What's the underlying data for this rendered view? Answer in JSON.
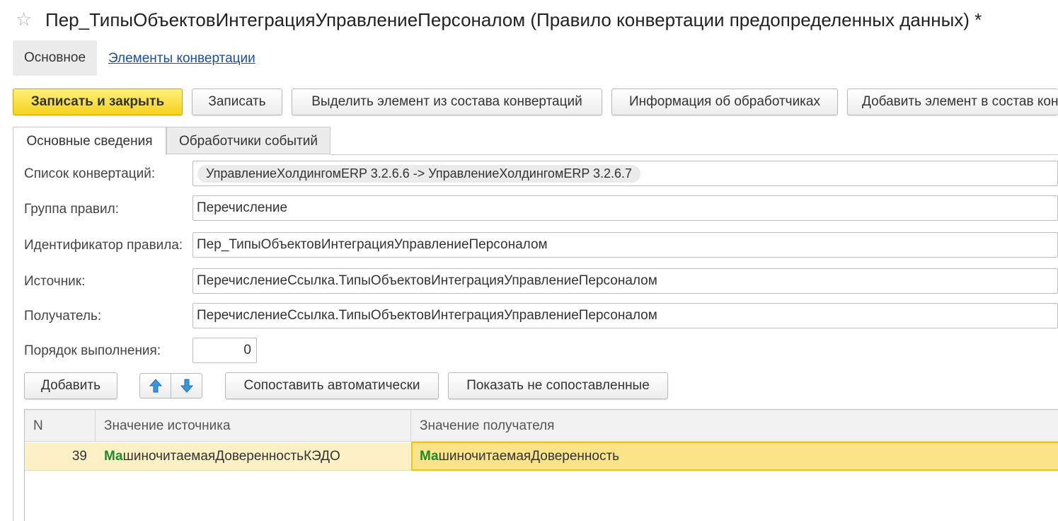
{
  "window": {
    "favorite_icon": "star-icon",
    "title": "Пер_ТипыОбъектовИнтеграцияУправлениеПерсоналом (Правило конвертации предопределенных данных) *"
  },
  "page_nav": {
    "active": "Основное",
    "link": "Элементы конвертации"
  },
  "toolbar": {
    "save_close": "Записать и закрыть",
    "save": "Записать",
    "extract_element": "Выделить элемент из состава конвертаций",
    "handlers_info": "Информация об обработчиках",
    "add_element": "Добавить элемент в состав конвертаций"
  },
  "tabs": [
    {
      "label": "Основные сведения",
      "active": true
    },
    {
      "label": "Обработчики событий",
      "active": false
    }
  ],
  "form": {
    "conversions_label": "Список конвертаций:",
    "conversions_value": "УправлениеХолдингомERP 3.2.6.6 -> УправлениеХолдингомERP 3.2.6.7",
    "group_label": "Группа правил:",
    "group_value": "Перечисление",
    "rule_id_label": "Идентификатор правила:",
    "rule_id_value": "Пер_ТипыОбъектовИнтеграцияУправлениеПерсоналом",
    "source_label": "Источник:",
    "source_value": "ПеречислениеСсылка.ТипыОбъектовИнтеграцияУправлениеПерсоналом",
    "receiver_label": "Получатель:",
    "receiver_value": "ПеречислениеСсылка.ТипыОбъектовИнтеграцияУправлениеПерсоналом",
    "order_label": "Порядок выполнения:",
    "order_value": "0"
  },
  "table_toolbar": {
    "add": "Добавить",
    "up_icon": "arrow-up-icon",
    "down_icon": "arrow-down-icon",
    "auto_match": "Сопоставить автоматически",
    "show_unmatched": "Показать не сопоставленные"
  },
  "table": {
    "columns": [
      "N",
      "Значение источника",
      "Значение получателя"
    ],
    "rows": [
      {
        "n": "39",
        "source_highlight": "Ма",
        "source_rest": "шиночитаемаяДоверенностьКЭДО",
        "target_highlight": "Ма",
        "target_rest": "шиночитаемаяДоверенность"
      }
    ]
  },
  "colors": {
    "primary_button": "#f6d21c",
    "selected_row": "#fbf1c4",
    "selected_cell": "#fbe38a",
    "search_highlight": "#1d8a2c",
    "link": "#1d4fa0"
  }
}
